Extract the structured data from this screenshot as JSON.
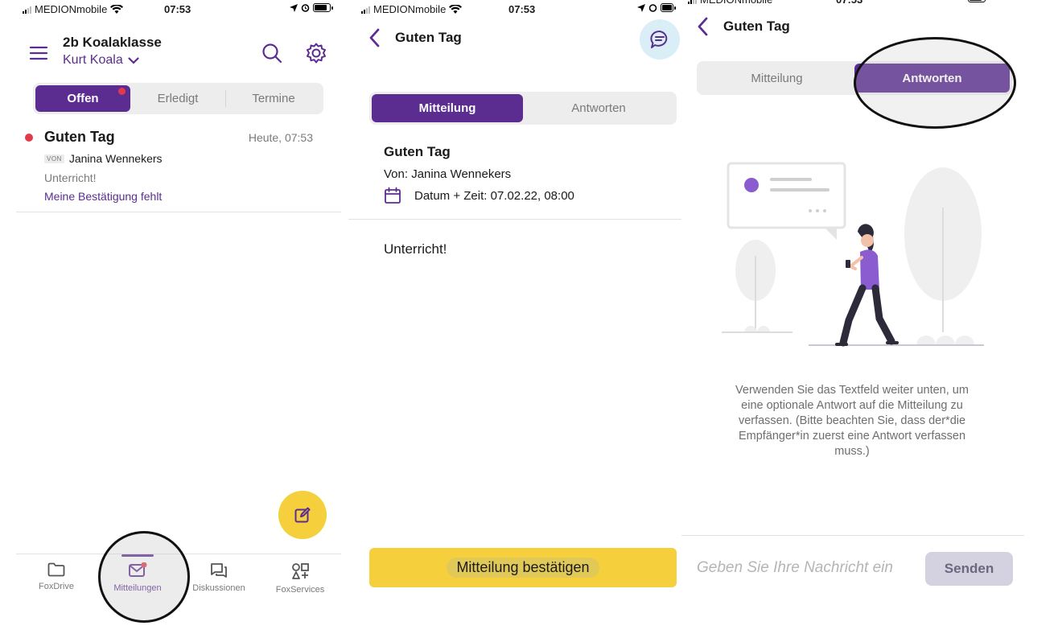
{
  "colors": {
    "brand": "#5b2d91",
    "accent_yellow": "#f5cf3c",
    "unread_red": "#e23a4a",
    "muted": "#7a7a7a"
  },
  "status": {
    "carrier": "MEDIONmobile",
    "time": "07:53"
  },
  "screen1": {
    "class_name": "2b Koalaklasse",
    "user_name": "Kurt Koala",
    "icons": {
      "menu": "hamburger-icon",
      "search": "search-icon",
      "settings": "gear-icon"
    },
    "tabs": [
      {
        "label": "Offen",
        "active": true,
        "badge": true
      },
      {
        "label": "Erledigt",
        "active": false
      },
      {
        "label": "Termine",
        "active": false
      }
    ],
    "message": {
      "title": "Guten Tag",
      "time": "Heute, 07:53",
      "from_badge": "VON",
      "from": "Janina Wennekers",
      "snippet": "Unterricht!",
      "status": "Meine Bestätigung fehlt"
    },
    "nav": [
      {
        "label": "FoxDrive",
        "icon": "folder-icon"
      },
      {
        "label": "Mitteilungen",
        "icon": "mail-icon",
        "active": true
      },
      {
        "label": "Diskussionen",
        "icon": "chat-icon"
      },
      {
        "label": "FoxServices",
        "icon": "services-icon"
      }
    ]
  },
  "screen2": {
    "title": "Guten Tag",
    "tabs": [
      {
        "label": "Mitteilung",
        "active": true
      },
      {
        "label": "Antworten",
        "active": false
      }
    ],
    "heading": "Guten Tag",
    "from": "Von: Janina Wennekers",
    "date": "Datum + Zeit: 07.02.22, 08:00",
    "body": "Unterricht!",
    "confirm_label": "Mitteilung bestätigen"
  },
  "screen3": {
    "title": "Guten Tag",
    "tabs": [
      {
        "label": "Mitteilung",
        "active": false
      },
      {
        "label": "Antworten",
        "active": true
      }
    ],
    "hint": "Verwenden Sie das Textfeld weiter unten, um eine optionale Antwort auf die Mitteilung zu verfassen. (Bitte beachten Sie, dass der*die Empfänger*in zuerst eine Antwort verfassen muss.)",
    "input_placeholder": "Geben Sie Ihre Nachricht ein",
    "send_label": "Senden"
  }
}
